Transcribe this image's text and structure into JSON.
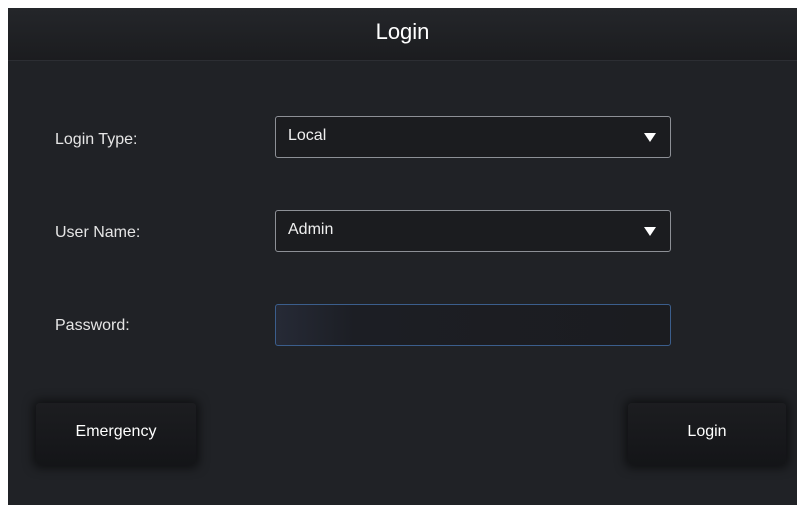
{
  "dialog": {
    "title": "Login"
  },
  "form": {
    "login_type": {
      "label": "Login Type:",
      "value": "Local"
    },
    "user_name": {
      "label": "User Name:",
      "value": "Admin"
    },
    "password": {
      "label": "Password:",
      "value": ""
    }
  },
  "buttons": {
    "emergency": "Emergency",
    "login": "Login"
  },
  "icons": {
    "dropdown": "dropdown-arrow-icon"
  }
}
